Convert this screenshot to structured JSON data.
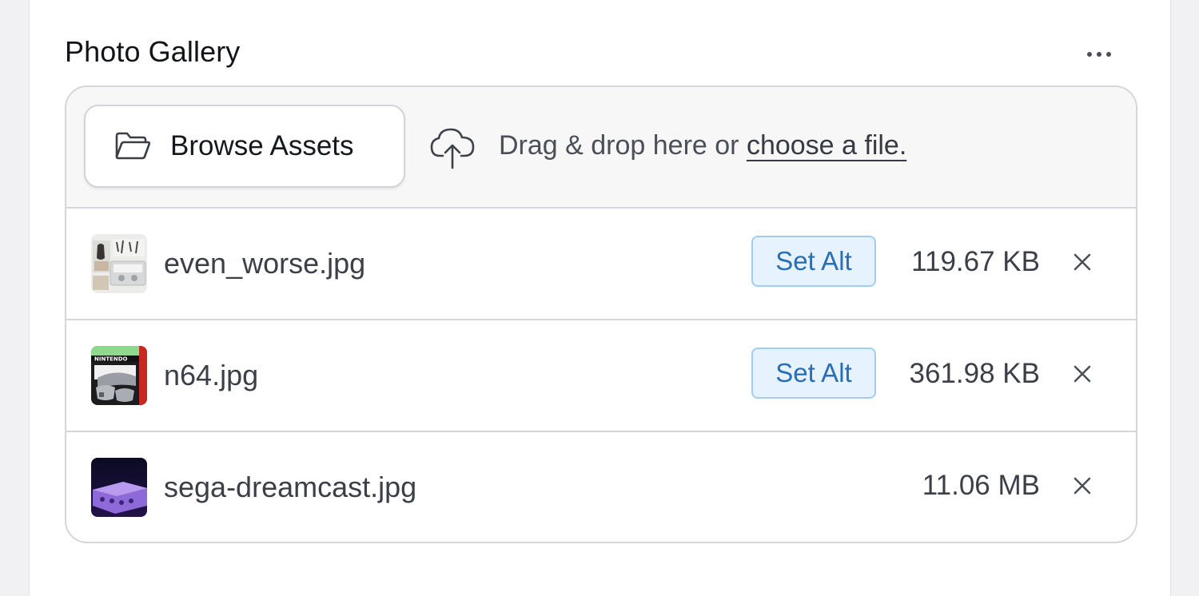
{
  "section": {
    "title": "Photo Gallery",
    "more_icon": "more-horizontal-icon"
  },
  "dropzone": {
    "browse_label": "Browse Assets",
    "browse_icon": "folder-open-icon",
    "upload_icon": "cloud-upload-icon",
    "drop_text": "Drag & drop here or ",
    "choose_link": "choose a file."
  },
  "files": [
    {
      "name": "even_worse.jpg",
      "size": "119.67 KB",
      "set_alt_label": "Set Alt",
      "remove_icon": "close-icon"
    },
    {
      "name": "n64.jpg",
      "size": "361.98 KB",
      "set_alt_label": "Set Alt",
      "remove_icon": "close-icon"
    },
    {
      "name": "sega-dreamcast.jpg",
      "size": "11.06 MB",
      "remove_icon": "close-icon"
    }
  ],
  "colors": {
    "set_alt_bg": "#e6f2fd",
    "set_alt_border": "#9fcdf5",
    "set_alt_text": "#2a6fb3"
  }
}
